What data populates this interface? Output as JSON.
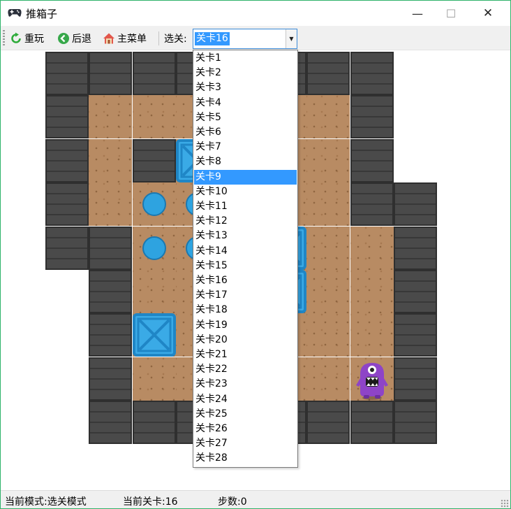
{
  "window": {
    "title": "推箱子",
    "minimize": "—",
    "maximize": "☐",
    "close": "✕"
  },
  "toolbar": {
    "replay": "重玩",
    "undo": "后退",
    "menu": "主菜单",
    "select_label": "选关:",
    "selected_level": "关卡16"
  },
  "level_list": [
    "关卡1",
    "关卡2",
    "关卡3",
    "关卡4",
    "关卡5",
    "关卡6",
    "关卡7",
    "关卡8",
    "关卡9",
    "关卡10",
    "关卡11",
    "关卡12",
    "关卡13",
    "关卡14",
    "关卡15",
    "关卡16",
    "关卡17",
    "关卡18",
    "关卡19",
    "关卡20",
    "关卡21",
    "关卡22",
    "关卡23",
    "关卡24",
    "关卡25",
    "关卡26",
    "关卡27",
    "关卡28"
  ],
  "highlighted_level": "关卡9",
  "status": {
    "mode": "当前模式:选关模式",
    "level": "当前关卡:16",
    "steps": "步数:0"
  },
  "colors": {
    "accent": "#3399ff",
    "window_border": "#2fb36a",
    "box": "#3aaae6",
    "target": "#2ea3e0",
    "wall": "#4a4a4a",
    "floor": "#b88b63",
    "player": "#8e44c7"
  },
  "icons": {
    "app": "gamepad-icon",
    "replay": "refresh-icon",
    "undo": "back-arrow-icon",
    "menu": "home-icon"
  },
  "board": {
    "rows": [
      "WWWWWWWWX",
      "W......WX",
      "W.W#...WX",
      "W.oo...WW",
      "WWoo.#..W",
      "XW..W$..W",
      "XW$.....W",
      "XW......W",
      "XWWWWWWWW"
    ]
  }
}
